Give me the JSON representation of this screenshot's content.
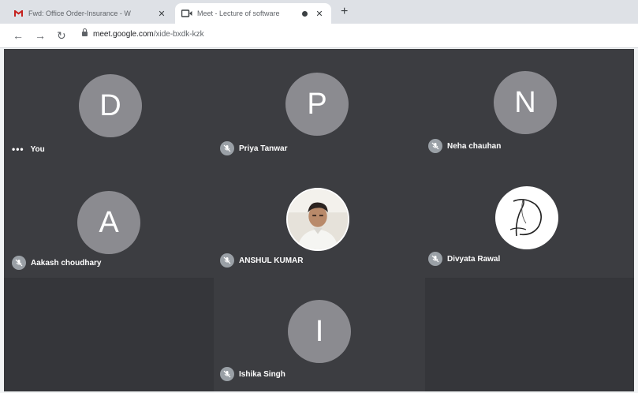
{
  "browser": {
    "tabs": [
      {
        "label": "Fwd: Office Order-Insurance - W",
        "icon": "gmail-icon",
        "active": false
      },
      {
        "label": "Meet - Lecture of software",
        "icon": "meet-icon",
        "active": true
      }
    ],
    "url_host": "meet.google.com",
    "url_path": "/xide-bxdk-kzk"
  },
  "participants": [
    {
      "initial": "D",
      "name": "You",
      "tag_icon": "more-options-icon"
    },
    {
      "initial": "P",
      "name": "Priya Tanwar",
      "tag_icon": "mic-muted-icon"
    },
    {
      "initial": "N",
      "name": "Neha chauhan",
      "tag_icon": "mic-muted-icon"
    },
    {
      "initial": "A",
      "name": "Aakash choudhary",
      "tag_icon": "mic-muted-icon"
    },
    {
      "initial": "",
      "name": "ANSHUL KUMAR",
      "tag_icon": "mic-muted-icon",
      "avatar_type": "photo"
    },
    {
      "initial": "",
      "name": "Divyata Rawal",
      "tag_icon": "mic-muted-icon",
      "avatar_type": "logo"
    },
    {
      "initial": "I",
      "name": "Ishika Singh",
      "tag_icon": "mic-muted-icon"
    }
  ],
  "colors": {
    "stage_bg": "#3c3d41",
    "avatar_bg": "#8b8b90",
    "tab_strip": "#dee1e6"
  }
}
